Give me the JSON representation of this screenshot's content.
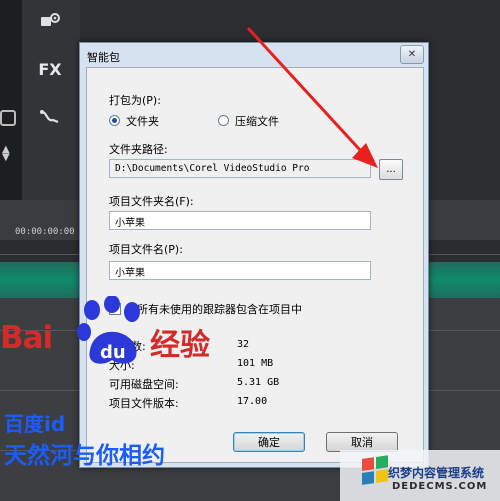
{
  "background_app": {
    "tools": [
      "FX"
    ],
    "timecode": "00:00:00:00"
  },
  "dialog": {
    "title": "智能包",
    "close_label": "✕",
    "package_as_label": "打包为(P):",
    "radio_options": [
      {
        "label": "文件夹",
        "selected": true
      },
      {
        "label": "压缩文件",
        "selected": false
      }
    ],
    "folder_path_label": "文件夹路径:",
    "folder_path_value": "D:\\Documents\\Corel VideoStudio Pro",
    "browse_label": "...",
    "project_folder_label": "项目文件夹名(F):",
    "project_folder_value": "小苹果",
    "project_file_label": "项目文件名(P):",
    "project_file_value": "小苹果",
    "include_trackers_label": "将所有未使用的跟踪器包含在项目中",
    "include_trackers_checked": false,
    "info_rows": [
      {
        "label": "文件数:",
        "value": "32"
      },
      {
        "label": "大小:",
        "value": "101 MB"
      },
      {
        "label": "可用磁盘空间:",
        "value": "5.31 GB"
      },
      {
        "label": "项目文件版本:",
        "value": "17.00"
      }
    ],
    "ok_label": "确定",
    "cancel_label": "取消"
  },
  "watermark": {
    "baidu": "Bai",
    "jingyan": "经验",
    "paw_text": "du",
    "line1": "百度id",
    "line2": "天然河与你相约"
  },
  "site_badge": {
    "cn": "织梦内容管理系统",
    "en": "DEDECMS.COM"
  },
  "colors": {
    "annotation_arrow": "#e8201e",
    "watermark_red": "#d32a2a",
    "watermark_blue": "#1a5cff"
  }
}
